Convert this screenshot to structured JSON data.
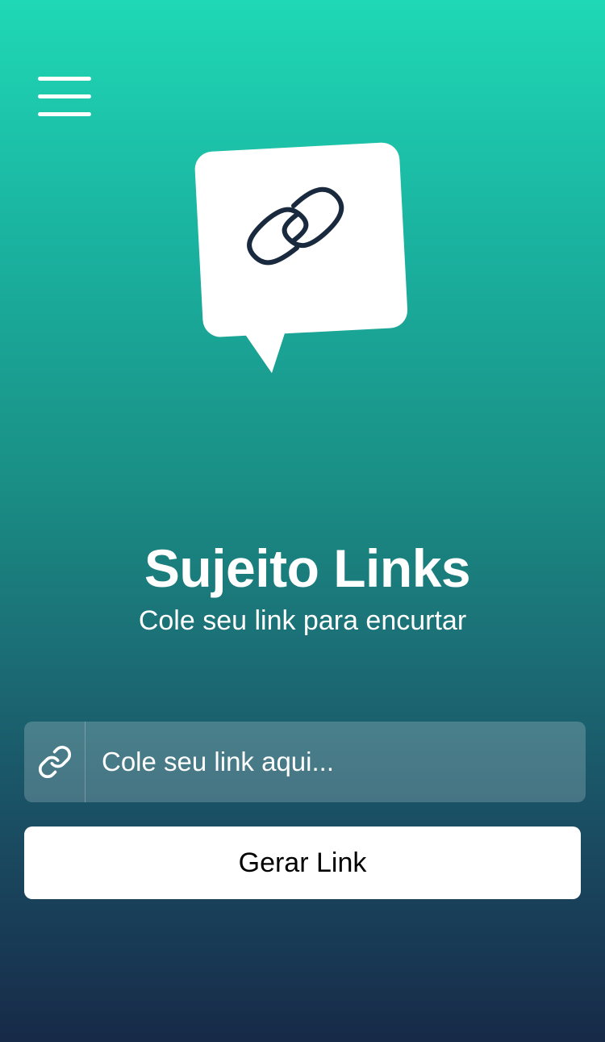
{
  "menu": {
    "icon": "hamburger-menu-icon"
  },
  "logo": {
    "icon": "chain-link-speech-bubble-icon",
    "bubble_color": "#ffffff",
    "link_color": "#1a2a3e"
  },
  "header": {
    "title": "Sujeito Links",
    "subtitle": "Cole seu link para encurtar"
  },
  "form": {
    "input_icon": "link-icon",
    "input_value": "",
    "input_placeholder": "Cole seu link aqui...",
    "button_label": "Gerar Link"
  },
  "colors": {
    "gradient_top": "#1fd8b5",
    "gradient_bottom": "#172a48",
    "button_background": "#ffffff",
    "button_text": "#000000"
  }
}
